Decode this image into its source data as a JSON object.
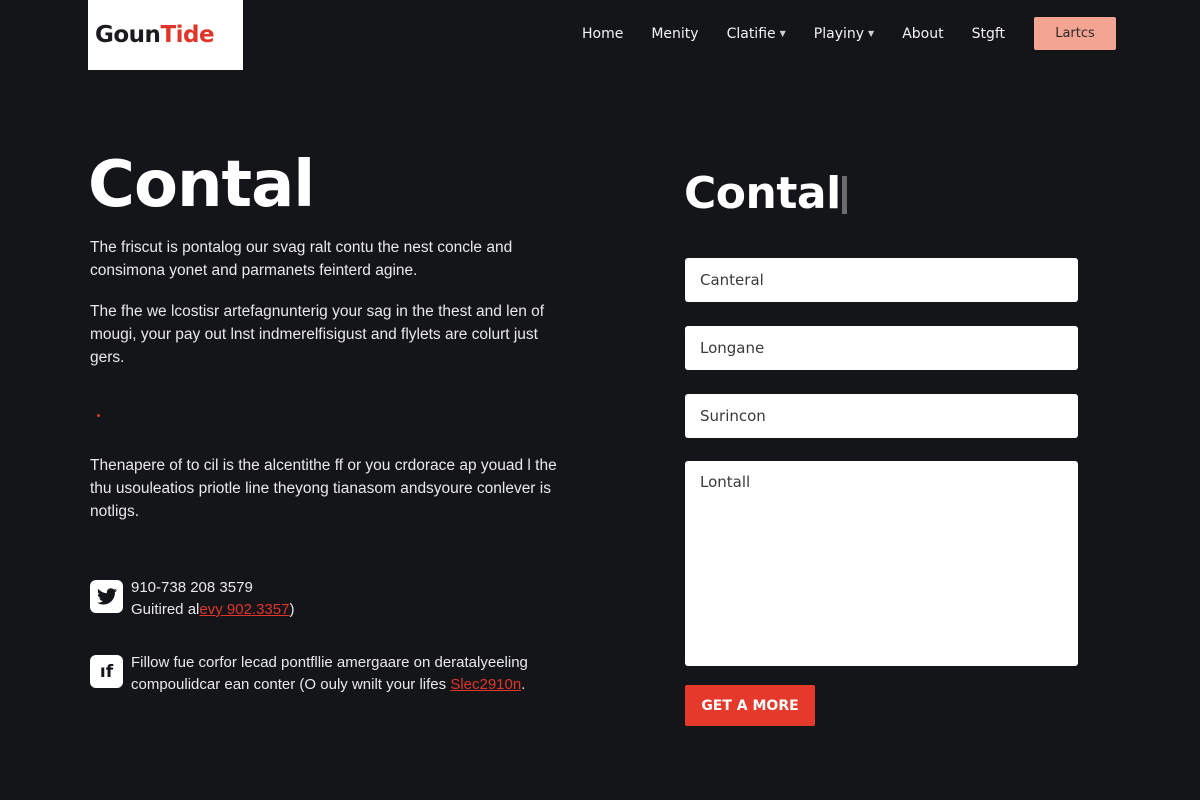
{
  "brand": {
    "part1": "Goun",
    "part2": "Tide",
    "accent_color": "#e0362a"
  },
  "nav": {
    "items": [
      {
        "label": "Home",
        "has_caret": false
      },
      {
        "label": "Menity",
        "has_caret": false
      },
      {
        "label": "Clatifie",
        "has_caret": true
      },
      {
        "label": "Playiny",
        "has_caret": true
      },
      {
        "label": "About",
        "has_caret": false
      },
      {
        "label": "Stgft",
        "has_caret": false
      }
    ],
    "cta_label": "Lartcs",
    "cta_color": "#f4a493"
  },
  "left": {
    "title": "Contal",
    "paragraph1": "The friscut is pontalog our svag ralt contu the nest concle and consimona yonet and parmanets feinterd agine.",
    "paragraph2": "The fhe we lcostisr artefagnunterig your sag in the thest and len of mougi, your pay out lnst indmerelfisigust and flylets are colurt just gers.",
    "paragraph3": "Thenapere of to cil is the alcentithe ff or you crdorace ap youad l the thu usouleatios priotle line theyong tianasom andsyoure conlever is notligs.",
    "contacts": [
      {
        "icon": "twitter-icon",
        "line1": "910-738 208 3579",
        "line2_prefix": "Guitired al",
        "line2_link": "evy 902.3357",
        "line2_suffix": ")"
      },
      {
        "icon": "if-icon",
        "line1": "Fillow fue corfor lecad pontfllie amergaare on deratalyeeling",
        "line2_prefix": "compoulidcar ean conter (O ouly wnilt your lifes ",
        "line2_link": "Slec2910n",
        "line2_suffix": "."
      }
    ]
  },
  "form": {
    "title": "Contal",
    "field1_placeholder": "Canteral",
    "field2_placeholder": "Longane",
    "field3_placeholder": "Surincon",
    "message_placeholder": "Lontall",
    "submit_label": "GET A MORE",
    "submit_color": "#e5392b"
  }
}
